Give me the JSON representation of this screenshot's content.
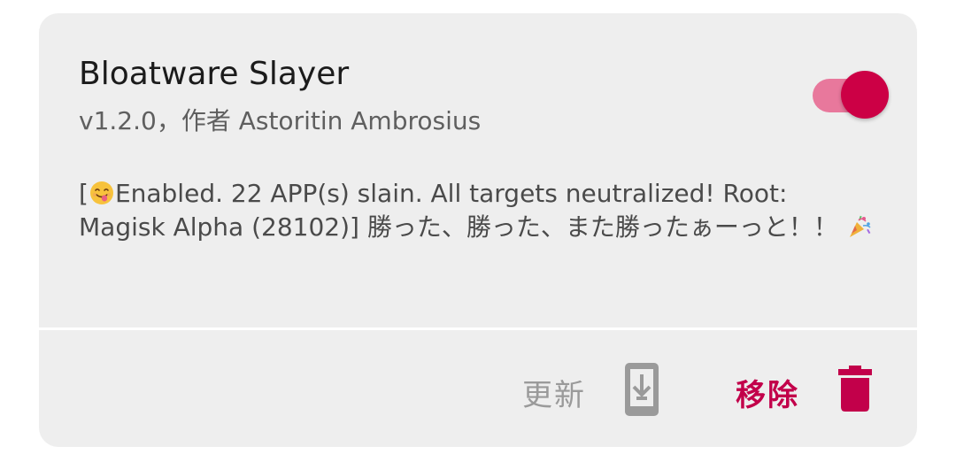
{
  "module": {
    "title": "Bloatware Slayer",
    "subtitle": "v1.2.0，作者 Astoritin Ambrosius",
    "enabled": true,
    "description_prefix": "[",
    "description_body": "Enabled. 22 APP(s) slain. All targets neutralized! Root: Magisk Alpha (28102)] 勝った、勝った、また勝ったぁーっと！！",
    "emoji_start": "smiling-face-with-tongue-emoji",
    "emoji_end": "party-popper-emoji"
  },
  "actions": {
    "update_label": "更新",
    "update_icon": "download-to-device-icon",
    "remove_label": "移除",
    "remove_icon": "trash-icon"
  },
  "colors": {
    "accent": "#c2004a",
    "toggle_track": "#e8789c",
    "toggle_thumb": "#cc0045",
    "card_bg": "#eeeeee",
    "disabled_text": "#9a9a9a"
  }
}
